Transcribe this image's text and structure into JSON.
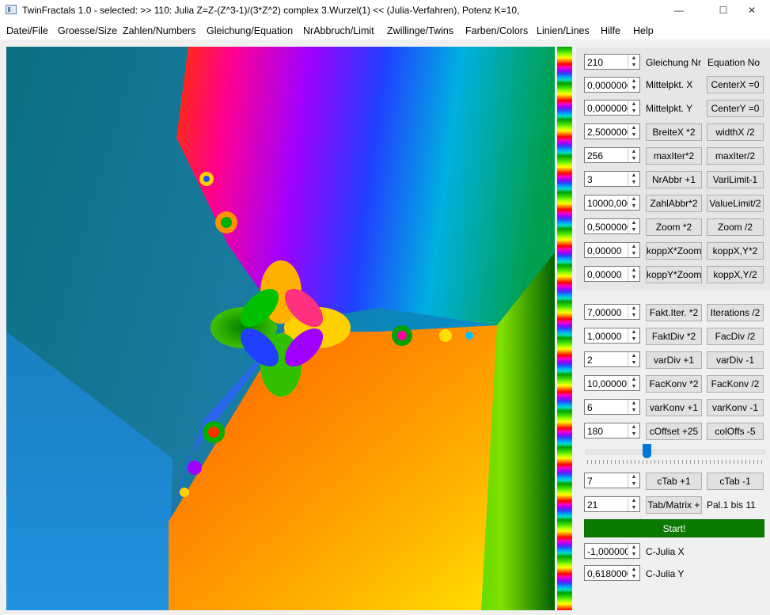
{
  "window": {
    "title": "TwinFractals 1.0 - selected: >> 110: Julia Z=Z-(Z^3-1)/(3*Z^2) complex 3.Wurzel(1)  << (Julia-Verfahren), Potenz K=10,",
    "min_symbol": "—",
    "max_symbol": "☐",
    "close_symbol": "✕"
  },
  "menu": [
    "Datei/File",
    "Groesse/Size",
    "Zahlen/Numbers",
    "Gleichung/Equation",
    "NrAbbruch/Limit",
    "Zwillinge/Twins",
    "Farben/Colors",
    "Linien/Lines",
    "Hilfe",
    "Help"
  ],
  "rows_top": [
    {
      "value": "210",
      "label": "Gleichung Nr",
      "label2": "Equation No"
    },
    {
      "value": "0,0000000",
      "label": "Mittelpkt. X",
      "btn2": "CenterX =0"
    },
    {
      "value": "0,0000000",
      "label": "Mittelpkt. Y",
      "btn2": "CenterY =0"
    },
    {
      "value": "2,5000000",
      "btn1": "BreiteX *2",
      "btn2": "widthX /2"
    },
    {
      "value": "256",
      "btn1": "maxIter*2",
      "btn2": "maxIter/2"
    },
    {
      "value": "3",
      "btn1": "NrAbbr +1",
      "btn2": "VariLimit-1"
    },
    {
      "value": "10000,000",
      "btn1": "ZahlAbbr*2",
      "btn2": "ValueLimit/2"
    },
    {
      "value": "0,5000000",
      "btn1": "Zoom *2",
      "btn2": "Zoom /2"
    },
    {
      "value": "0,00000",
      "btn1": "koppX*Zoom",
      "btn2": "koppX,Y*2"
    },
    {
      "value": "0,00000",
      "btn1": "koppY*Zoom",
      "btn2": "koppX,Y/2"
    }
  ],
  "rows_mid": [
    {
      "value": "7,00000",
      "btn1": "Fakt.Iter. *2",
      "btn2": "Iterations /2"
    },
    {
      "value": "1,00000",
      "btn1": "FaktDiv *2",
      "btn2": "FacDiv /2"
    },
    {
      "value": "2",
      "btn1": "varDiv +1",
      "btn2": "varDiv -1"
    },
    {
      "value": "10,00000",
      "btn1": "FacKonv *2",
      "btn2": "FacKonv /2"
    },
    {
      "value": "6",
      "btn1": "varKonv +1",
      "btn2": "varKonv -1"
    },
    {
      "value": "180",
      "btn1": "cOffset +25",
      "btn2": "colOffs -5"
    }
  ],
  "slider": {
    "position_fraction": 0.34
  },
  "rows_bottom": [
    {
      "value": "7",
      "btn1": "cTab +1",
      "btn2": "cTab -1"
    },
    {
      "value": "21",
      "btn1": "Tab/Matrix +",
      "label": "Pal.1 bis 11"
    }
  ],
  "start_label": "Start!",
  "julia": [
    {
      "value": "-1,0000000",
      "label": "C-Julia X"
    },
    {
      "value": "0,6180000",
      "label": "C-Julia Y"
    }
  ]
}
